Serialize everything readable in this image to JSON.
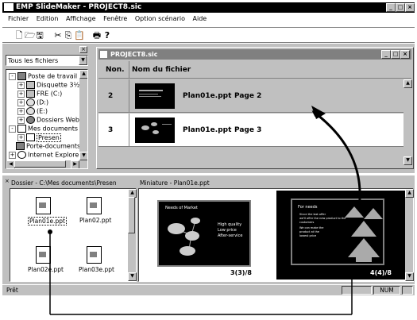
{
  "app": {
    "title": "EMP SlideMaker - PROJECT8.sic",
    "logo_text": "EMP"
  },
  "menu": [
    "Fichier",
    "Edition",
    "Affichage",
    "Fenêtre",
    "Option scénario",
    "Aide"
  ],
  "toolbar_icons": [
    "new-icon",
    "open-icon",
    "save-icon",
    "cut-icon",
    "copy-icon",
    "paste-icon",
    "print-icon",
    "help-icon"
  ],
  "explorer": {
    "dropdown_value": "Tous les fichiers",
    "tree": [
      {
        "label": "Poste de travail",
        "indent": 0,
        "expander": "-",
        "icon": "computer-icon"
      },
      {
        "label": "Disquette 3½",
        "indent": 1,
        "expander": "+",
        "icon": "floppy-icon"
      },
      {
        "label": "FRE (C:)",
        "indent": 1,
        "expander": "+",
        "icon": "drive-icon"
      },
      {
        "label": "(D:)",
        "indent": 1,
        "expander": "+",
        "icon": "cd-icon"
      },
      {
        "label": "(E:)",
        "indent": 1,
        "expander": "+",
        "icon": "cd-icon"
      },
      {
        "label": "Dossiers Web",
        "indent": 1,
        "expander": "+",
        "icon": "web-folder-icon"
      },
      {
        "label": "Mes documents",
        "indent": 0,
        "expander": "-",
        "icon": "folder-icon"
      },
      {
        "label": "Presen",
        "indent": 1,
        "expander": "+",
        "icon": "folder-icon",
        "selected": true
      },
      {
        "label": "Porte-documents",
        "indent": 0,
        "expander": "",
        "icon": "briefcase-icon"
      },
      {
        "label": "Internet Explorer",
        "indent": 0,
        "expander": "+",
        "icon": "ie-icon"
      }
    ]
  },
  "project_window": {
    "title": "PROJECT8.sic",
    "col_no": "Non.",
    "col_file": "Nom du fichier",
    "rows": [
      {
        "no": "2",
        "file": "Plan01e.ppt",
        "page": "Page 2",
        "selected": true
      },
      {
        "no": "3",
        "file": "Plan01e.ppt",
        "page": "Page 3",
        "selected": false
      }
    ]
  },
  "folder_panel": {
    "title": "Dossier - C:\\Mes documents\\Presen",
    "files": [
      "Plan01e.ppt",
      "Plan02.ppt",
      "Plan02e.ppt",
      "Plan03e.ppt"
    ]
  },
  "thumb_panel": {
    "title": "Miniature - Plan01e.ppt",
    "thumbs": [
      {
        "label": "3(3)/8",
        "slide_title": "Needs of Market",
        "bullets": [
          "High quality",
          "Low price",
          "After-service"
        ]
      },
      {
        "label": "4(4)/8",
        "slide_title": "For needs",
        "bullets": [
          "Since the last offer",
          "we'll offer the new product to the",
          "customers",
          "We can make the",
          "product at the",
          "lowest price"
        ]
      }
    ]
  },
  "status": {
    "text": "Prêt",
    "num": "NUM"
  }
}
